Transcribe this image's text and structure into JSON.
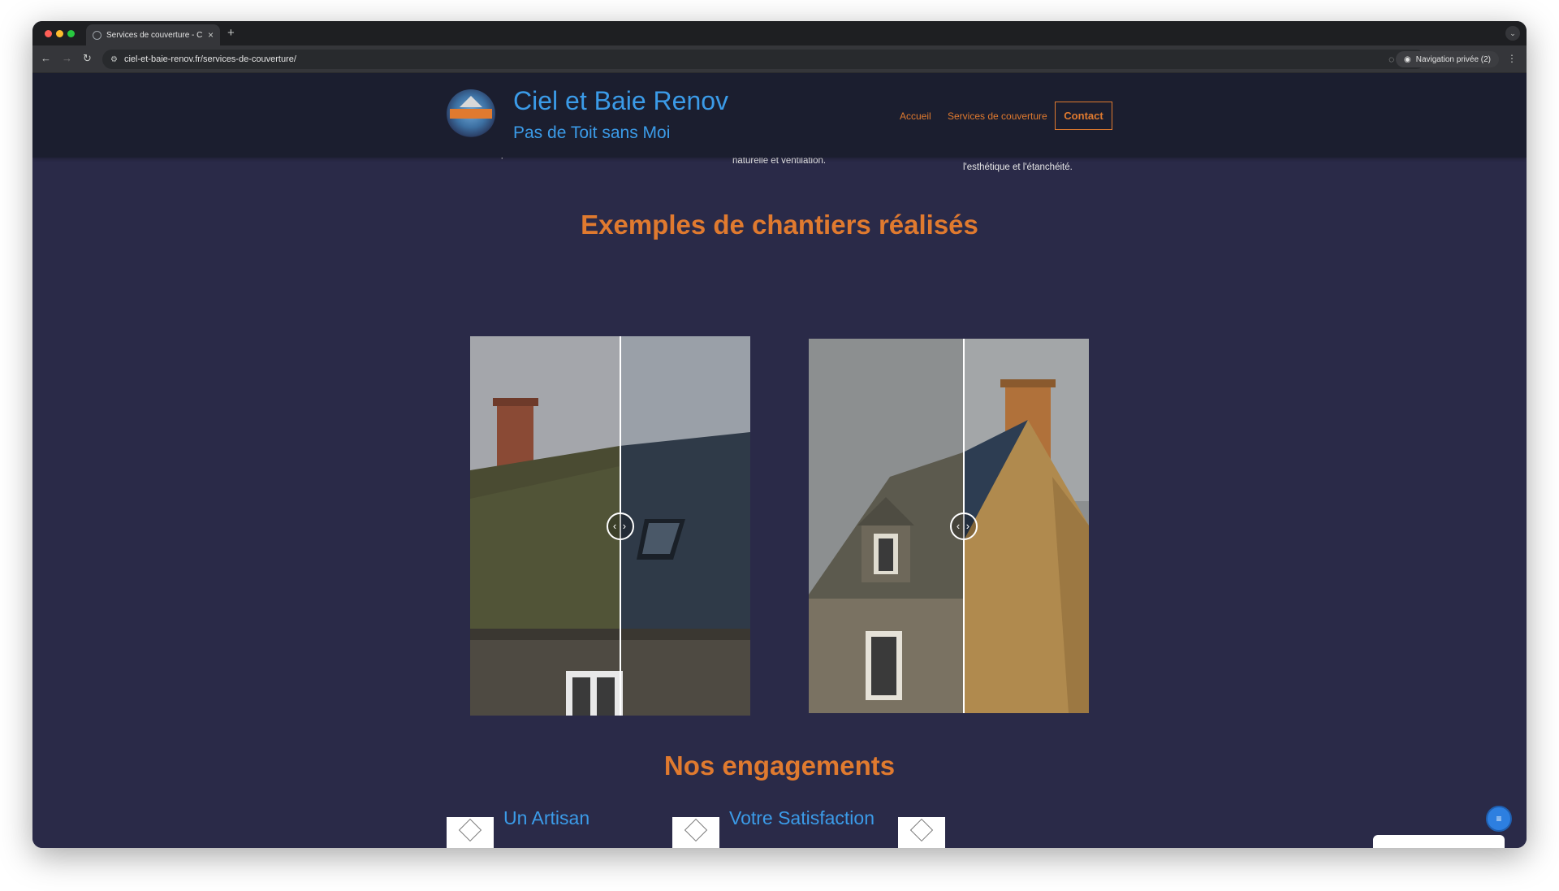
{
  "browser": {
    "tab_title": "Services de couverture - Ciel",
    "tab_close": "×",
    "new_tab": "+",
    "url": "ciel-et-baie-renov.fr/services-de-couverture/",
    "private_label": "Navigation privée (2)",
    "icons": [
      "back-icon",
      "forward-icon",
      "reload-icon",
      "site-info-icon",
      "eye-off-icon",
      "star-icon",
      "incognito-icon",
      "kebab-icon",
      "tab-menu-icon"
    ]
  },
  "header": {
    "site_title": "Ciel et Baie Renov",
    "tagline": "Pas de Toit sans Moi",
    "nav": {
      "accueil": "Accueil",
      "services": "Services de couverture",
      "contact": "Contact"
    }
  },
  "previous_section": {
    "text_1": "pluviales.",
    "text_2": "naturelle et ventilation.",
    "text_3": "l'esthétique et l'étanchéité."
  },
  "examples": {
    "heading": "Exemples de chantiers réalisés",
    "sliders": [
      {
        "handle": "‹ ›",
        "position": 0.535
      },
      {
        "handle": "‹ ›",
        "position": 0.55
      }
    ]
  },
  "engagements": {
    "heading": "Nos engagements",
    "items": [
      {
        "title": "Un Artisan"
      },
      {
        "title": "Votre Satisfaction"
      }
    ]
  },
  "colors": {
    "accent_orange": "#e07a2f",
    "link_blue": "#3b9be8",
    "page_bg": "#2a2a48",
    "header_bg": "#1b1e2f"
  }
}
